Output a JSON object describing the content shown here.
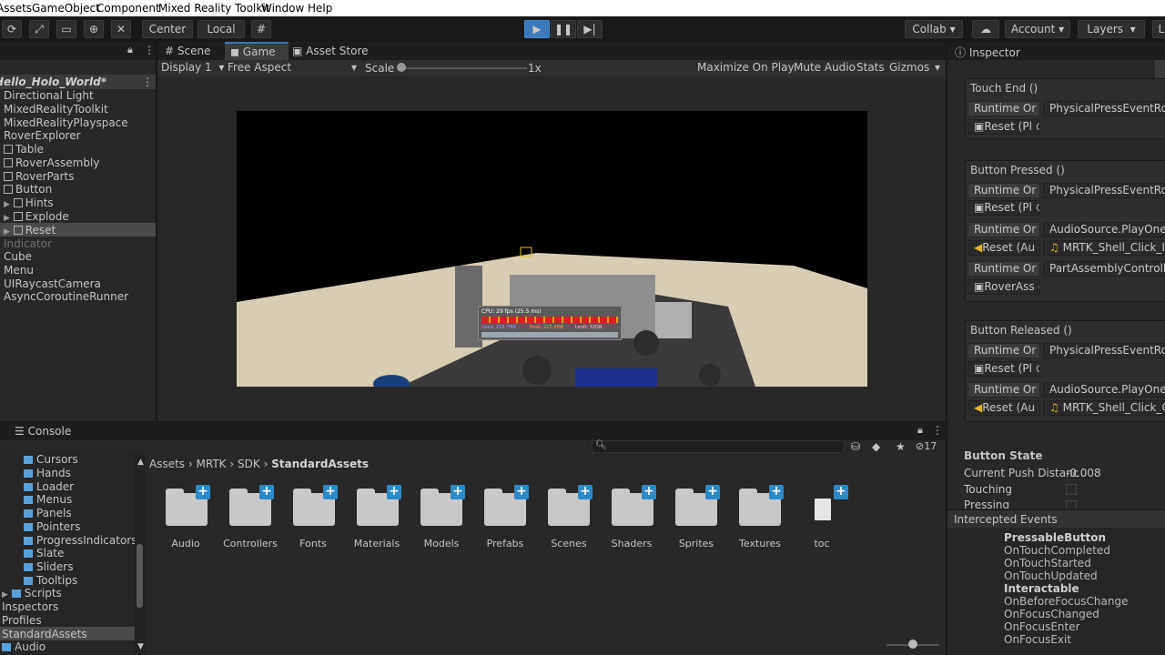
{
  "menu": [
    "Assets",
    "GameObject",
    "Component",
    "Mixed Reality Toolkit",
    "Window",
    "Help"
  ],
  "toolbar": {
    "center": "Center",
    "local": "Local",
    "collab": "Collab",
    "account": "Account",
    "layers": "Layers",
    "layout": "L"
  },
  "hierarchy": {
    "scene": "Hello_Holo_World*",
    "items": [
      "Directional Light",
      "MixedRealityToolkit",
      "MixedRealityPlayspace",
      "RoverExplorer",
      "Table",
      "RoverAssembly",
      "RoverParts",
      "Button",
      "Hints",
      "Explode",
      "Reset",
      "Indicator",
      "Cube",
      "Menu",
      "UIRaycastCamera",
      "AsyncCoroutineRunner"
    ]
  },
  "view_tabs": [
    "Scene",
    "Game",
    "Asset Store"
  ],
  "game_bar": {
    "display": "Display 1",
    "aspect": "Free Aspect",
    "scale_label": "Scale",
    "scale_value": "1x",
    "maximize": "Maximize On Play",
    "mute": "Mute Audio",
    "stats": "Stats",
    "gizmos": "Gizmos"
  },
  "overlay": {
    "cpu": "CPU: 29 fps (25.5 ms)",
    "used": "Used: 218.7MB",
    "peak": "Peak: 225.8MB",
    "limit": "Limit: 32GB"
  },
  "console": {
    "title": "Console",
    "badge": "17"
  },
  "project": {
    "tree": [
      "Cursors",
      "Hands",
      "Loader",
      "Menus",
      "Panels",
      "Pointers",
      "ProgressIndicators",
      "Slate",
      "Sliders",
      "Tooltips",
      "Scripts",
      "Inspectors",
      "Profiles",
      "StandardAssets",
      "Audio"
    ],
    "breadcrumb": [
      "Assets",
      "MRTK",
      "SDK",
      "StandardAssets"
    ],
    "folders": [
      "Audio",
      "Controllers",
      "Fonts",
      "Materials",
      "Models",
      "Prefabs",
      "Scenes",
      "Shaders",
      "Sprites",
      "Textures",
      "toc"
    ]
  },
  "inspector": {
    "title": "Inspector",
    "touch_end": "Touch End ()",
    "button_pressed": "Button Pressed ()",
    "button_released": "Button Released ()",
    "runtime": "Runtime Or",
    "phys": "PhysicalPressEventRout",
    "reset_pl": "Reset (Pl",
    "audio_fn": "AudioSource.PlayOneSh",
    "reset_au": "Reset (Au",
    "clip_in": "MRTK_Shell_Click_In",
    "part_fn": "PartAssemblyController.",
    "rover_as": "RoverAss",
    "clip_out": "MRTK_Shell_Click_Out",
    "button_state": "Button State",
    "push_label": "Current Push Distanc",
    "push_value": "-0.008",
    "touching": "Touching",
    "pressing": "Pressing",
    "intercepted": "Intercepted Events",
    "events": [
      {
        "text": "PressableButton",
        "bold": true
      },
      {
        "text": "OnTouchCompleted",
        "bold": false
      },
      {
        "text": "OnTouchStarted",
        "bold": false
      },
      {
        "text": "OnTouchUpdated",
        "bold": false
      },
      {
        "text": "Interactable",
        "bold": true
      },
      {
        "text": "OnBeforeFocusChange",
        "bold": false
      },
      {
        "text": "OnFocusChanged",
        "bold": false
      },
      {
        "text": "OnFocusEnter",
        "bold": false
      },
      {
        "text": "OnFocusExit",
        "bold": false
      }
    ]
  }
}
